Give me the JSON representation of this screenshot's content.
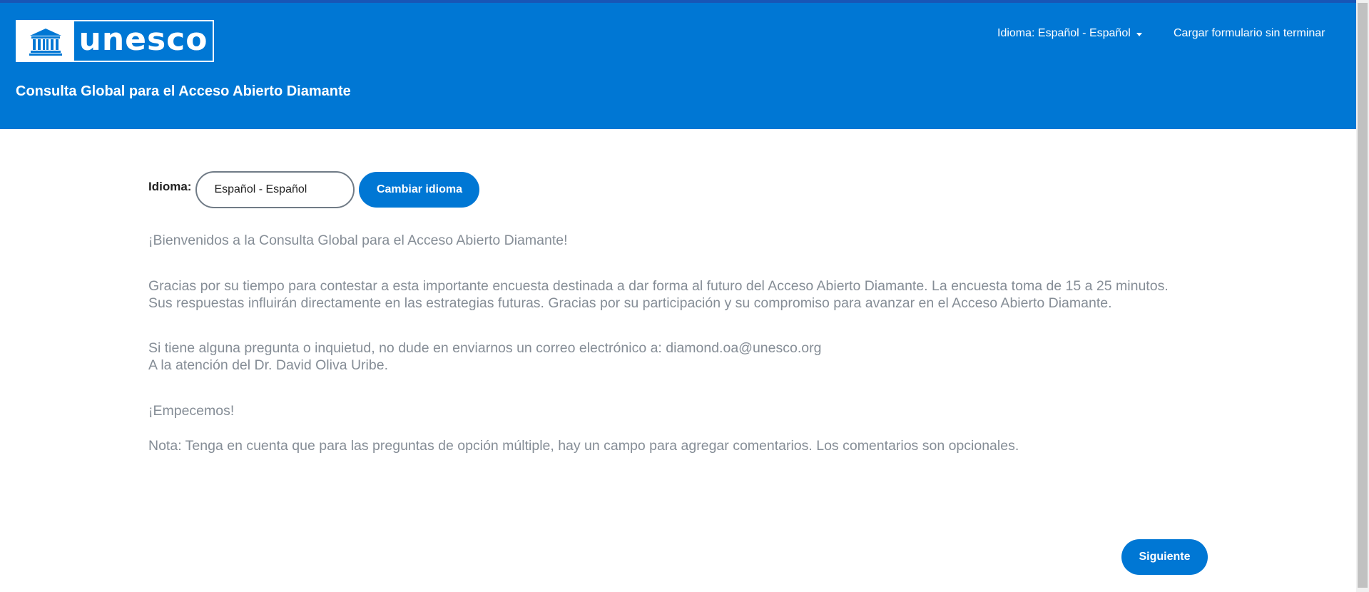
{
  "header": {
    "logo_text": "unesco",
    "site_title": "Consulta Global para el Acceso Abierto Diamante",
    "nav_language": "Idioma: Español - Español",
    "nav_load_form": "Cargar formulario sin terminar"
  },
  "language": {
    "label": "Idioma:",
    "selected": "Español - Español",
    "change_button": "Cambiar idioma"
  },
  "content": {
    "welcome": "¡Bienvenidos a la Consulta Global para el Acceso Abierto Diamante!",
    "thanks_line1": "Gracias por su tiempo para contestar a esta importante encuesta destinada a dar forma al futuro del Acceso Abierto Diamante. La encuesta toma de 15 a 25 minutos.",
    "thanks_line2": "Sus respuestas influirán directamente en las estrategias futuras. Gracias por su participación y su compromiso para avanzar en el Acceso Abierto Diamante.",
    "contact_line1": "Si tiene alguna pregunta o inquietud, no dude en enviarnos un correo electrónico a: diamond.oa@unesco.org",
    "contact_line2": "A la atención del Dr. David Oliva Uribe.",
    "start": "¡Empecemos!",
    "note": "Nota: Tenga en cuenta que para las preguntas de opción múltiple, hay un campo para agregar comentarios. Los comentarios son opcionales."
  },
  "footer": {
    "next_button": "Siguiente"
  },
  "colors": {
    "brand_blue": "#0077d4",
    "body_text": "#858d96"
  }
}
